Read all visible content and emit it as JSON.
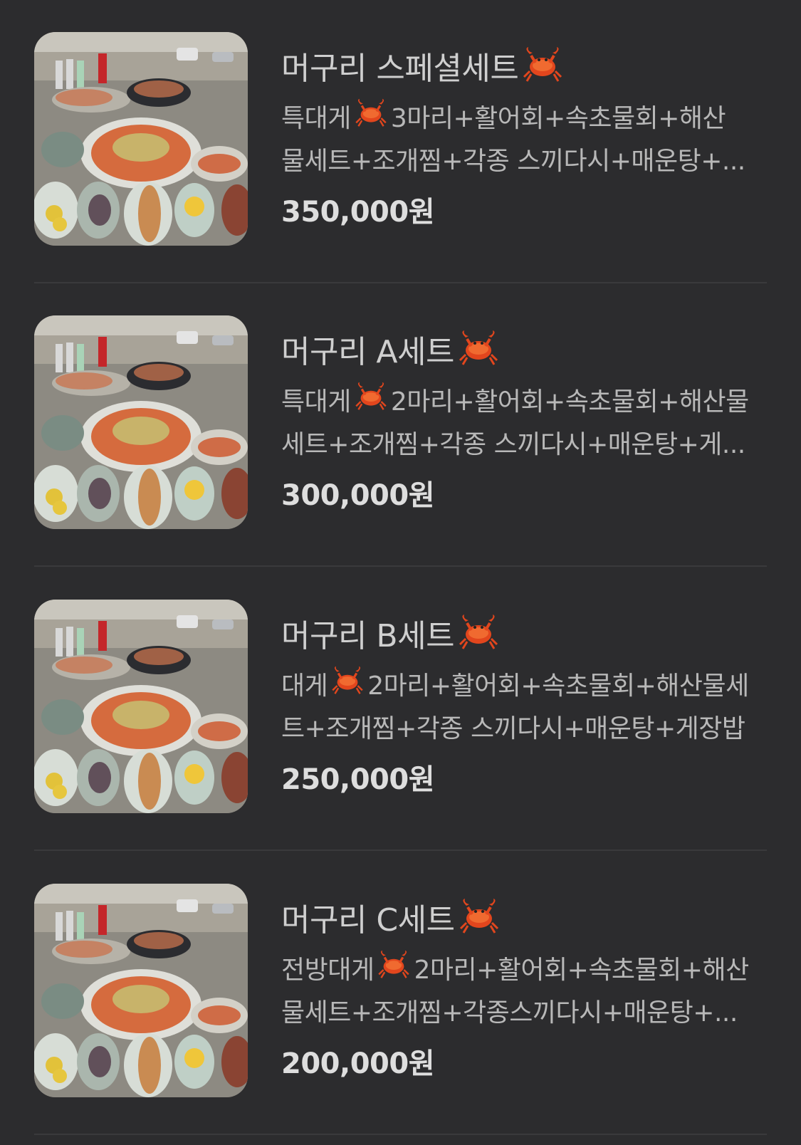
{
  "menu": {
    "items": [
      {
        "title": "머구리 스페셜세트",
        "desc_line1_pre": "특대게",
        "desc_line1_post": "3마리+활어회+속초물회+해산",
        "desc_line2": "물세트+조개찜+각종 스끼다시+매운탕+...",
        "price": "350,000원"
      },
      {
        "title": "머구리 A세트",
        "desc_line1_pre": "특대게",
        "desc_line1_post": "2마리+활어회+속초물회+해산물",
        "desc_line2": "세트+조개찜+각종 스끼다시+매운탕+게...",
        "price": "300,000원"
      },
      {
        "title": "머구리 B세트",
        "desc_line1_pre": "대게",
        "desc_line1_post": "2마리+활어회+속초물회+해산물세",
        "desc_line2": "트+조개찜+각종 스끼다시+매운탕+게장밥",
        "price": "250,000원"
      },
      {
        "title": "머구리 C세트",
        "desc_line1_pre": "전방대게",
        "desc_line1_post": "2마리+활어회+속초물회+해산",
        "desc_line2": "물세트+조개찜+각종스끼다시+매운탕+...",
        "price": "200,000원"
      }
    ],
    "icon": "crab-icon",
    "photo": "seafood-platter-photo"
  }
}
